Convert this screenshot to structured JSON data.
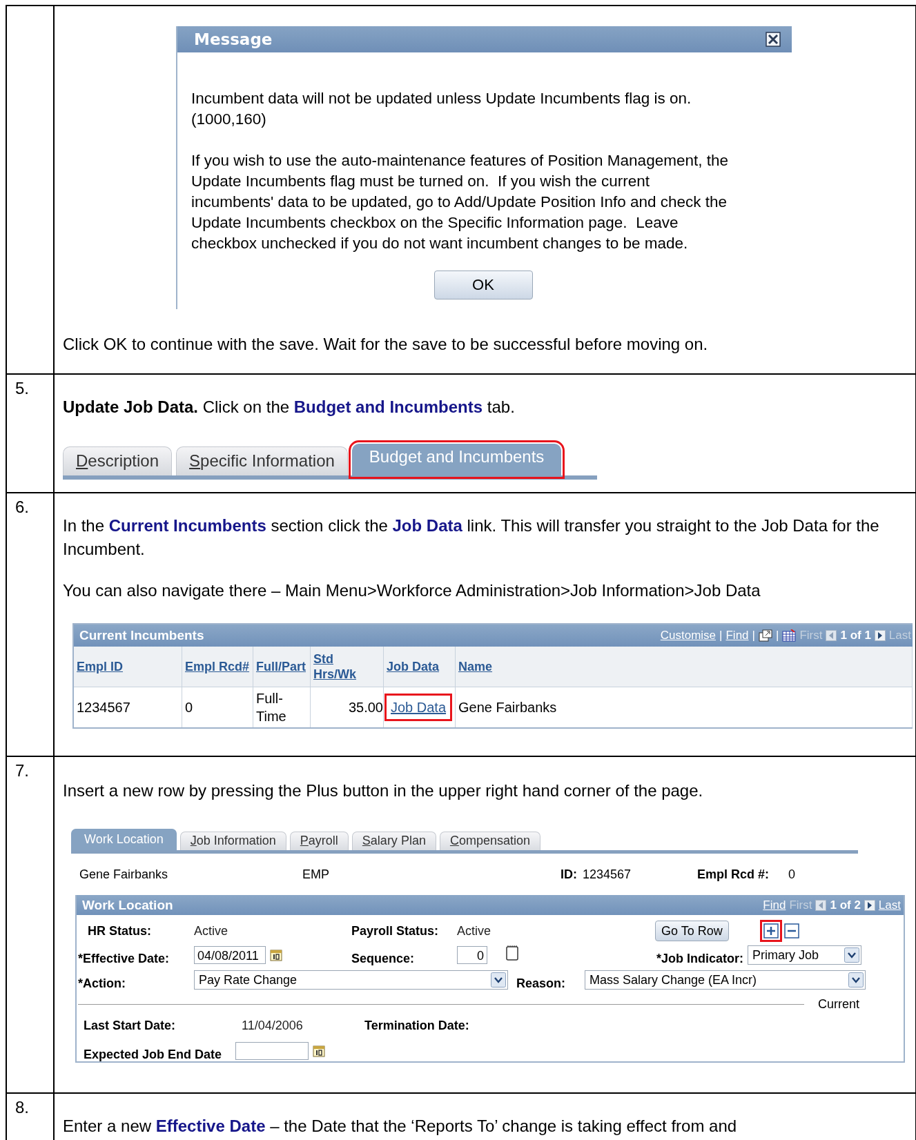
{
  "rows": [
    {
      "kind": "message",
      "dialog": {
        "title": "Message",
        "paragraphs": [
          [
            "Incumbent data will not be updated unless Update Incumbents flag is on.",
            "(1000,160)"
          ],
          [
            "If you wish to use the auto-maintenance features of Position Management, the",
            "Update Incumbents flag must be turned on.  If you wish the current",
            "incumbents' data to be updated, go to Add/Update Position Info and check the",
            "Update Incumbents checkbox on the Specific Information page.  Leave",
            "checkbox unchecked if you do not want incumbent changes to be made."
          ]
        ],
        "button": "OK"
      },
      "paragraphs": [
        [
          {
            "kind": "plain",
            "text": "Click OK to continue with the save. Wait for the save to be successful before moving on."
          }
        ]
      ]
    },
    {
      "kind": "tabs",
      "number": "5.",
      "paragraphs": [
        [
          {
            "kind": "bold",
            "text": "Update Job Data."
          },
          {
            "kind": "plain",
            "text": " Click on the "
          },
          {
            "kind": "term",
            "text": "Budget and Incumbents"
          },
          {
            "kind": "plain",
            "text": " tab."
          }
        ]
      ],
      "tabs": [
        {
          "hotkey": "D",
          "rest": "escription",
          "selected": false,
          "highlighted": false
        },
        {
          "hotkey": "S",
          "rest": "pecific Information",
          "selected": false,
          "highlighted": false
        },
        {
          "label": "Budget and Incumbents",
          "selected": true,
          "highlighted": true
        }
      ]
    },
    {
      "kind": "grid",
      "number": "6.",
      "paragraphs": [
        [
          {
            "kind": "plain",
            "text": "In the "
          },
          {
            "kind": "term",
            "text": "Current Incumbents"
          },
          {
            "kind": "plain",
            "text": " section click the "
          },
          {
            "kind": "term",
            "text": "Job Data"
          },
          {
            "kind": "plain",
            "text": " link. This will transfer you straight to the Job Data for the Incumbent."
          }
        ],
        [
          {
            "kind": "plain",
            "text": "You can also navigate there – Main Menu>Workforce Administration>Job Information>Job Data"
          }
        ]
      ],
      "grid": {
        "title": "Current Incumbents",
        "nav": [
          {
            "kind": "link",
            "text": "Customise",
            "disabled": false
          },
          {
            "kind": "sep",
            "text": "|"
          },
          {
            "kind": "link",
            "text": "Find",
            "disabled": false
          },
          {
            "kind": "sep",
            "text": "|"
          },
          {
            "kind": "new_window"
          },
          {
            "kind": "sep",
            "text": "|"
          },
          {
            "kind": "spreadsheet"
          },
          {
            "kind": "link",
            "text": "First",
            "disabled": true
          },
          {
            "kind": "prev"
          },
          {
            "kind": "count",
            "text": "1 of 1"
          },
          {
            "kind": "next"
          },
          {
            "kind": "link",
            "text": "Last",
            "disabled": true
          }
        ],
        "columns": [
          "Empl ID",
          "Empl Rcd#",
          "Full/Part",
          "Std Hrs/Wk",
          "Job Data",
          "Name"
        ],
        "rows": [
          {
            "cells": [
              {
                "kind": "text",
                "text": "1234567",
                "highlighted": false
              },
              {
                "kind": "text",
                "text": "0",
                "highlighted": false
              },
              {
                "kind": "text",
                "text": "Full-Time",
                "highlighted": false
              },
              {
                "kind": "number",
                "text": "35.00",
                "highlighted": false
              },
              {
                "kind": "link",
                "text": "Job Data",
                "highlighted": true
              },
              {
                "kind": "text",
                "text": "Gene Fairbanks",
                "highlighted": false
              }
            ]
          }
        ]
      }
    },
    {
      "kind": "job_form",
      "number": "7.",
      "paragraphs": [
        [
          {
            "kind": "plain",
            "text": "Insert a new row by pressing the Plus button in the upper right hand corner of the page."
          }
        ]
      ],
      "form": {
        "tabs": [
          {
            "label": "Work Location",
            "selected": true
          },
          {
            "hotkey": "J",
            "rest": "ob Information",
            "selected": false
          },
          {
            "hotkey": "P",
            "rest": "ayroll",
            "selected": false
          },
          {
            "hotkey": "S",
            "rest": "alary Plan",
            "selected": false
          },
          {
            "hotkey": "C",
            "rest": "ompensation",
            "selected": false
          }
        ],
        "header": {
          "name": "Gene Fairbanks",
          "type": "EMP",
          "id_label": "ID:",
          "id": "1234567",
          "rcd_label": "Empl Rcd #:",
          "rcd": "0"
        },
        "section": {
          "title": "Work Location",
          "nav": [
            {
              "kind": "link",
              "text": "Find",
              "disabled": false
            },
            {
              "kind": "link",
              "text": "First",
              "disabled": true
            },
            {
              "kind": "prev"
            },
            {
              "kind": "count",
              "text": "1 of 2"
            },
            {
              "kind": "next"
            },
            {
              "kind": "link",
              "text": "Last",
              "disabled": false
            }
          ]
        },
        "go_to_row": "Go To Row",
        "add_row_highlighted": true,
        "hr_status": {
          "label": "HR Status:",
          "value": "Active"
        },
        "payroll_status": {
          "label": "Payroll Status:",
          "value": "Active"
        },
        "effective_date": {
          "label": "*Effective Date:",
          "value": "04/08/2011"
        },
        "sequence": {
          "label": "Sequence:",
          "value": "0"
        },
        "job_indicator": {
          "label": "*Job Indicator:",
          "value": "Primary Job"
        },
        "action": {
          "label": "*Action:",
          "value": "Pay Rate Change"
        },
        "reason": {
          "label": "Reason:",
          "value": "Mass Salary Change (EA Incr)"
        },
        "divider_label": "Current",
        "last_start_date": {
          "label": "Last Start Date:",
          "value": "11/04/2006"
        },
        "termination_date": {
          "label": "Termination Date:"
        },
        "expected_job_end_date": {
          "label": "Expected Job End Date"
        }
      }
    },
    {
      "kind": "text",
      "number": "8.",
      "paragraphs": [
        [
          {
            "kind": "plain",
            "text": "Enter a new "
          },
          {
            "kind": "term",
            "text": "Effective Date"
          },
          {
            "kind": "plain",
            "text": " – the Date that the ‘Reports To’ change is taking effect from and"
          }
        ]
      ]
    }
  ]
}
